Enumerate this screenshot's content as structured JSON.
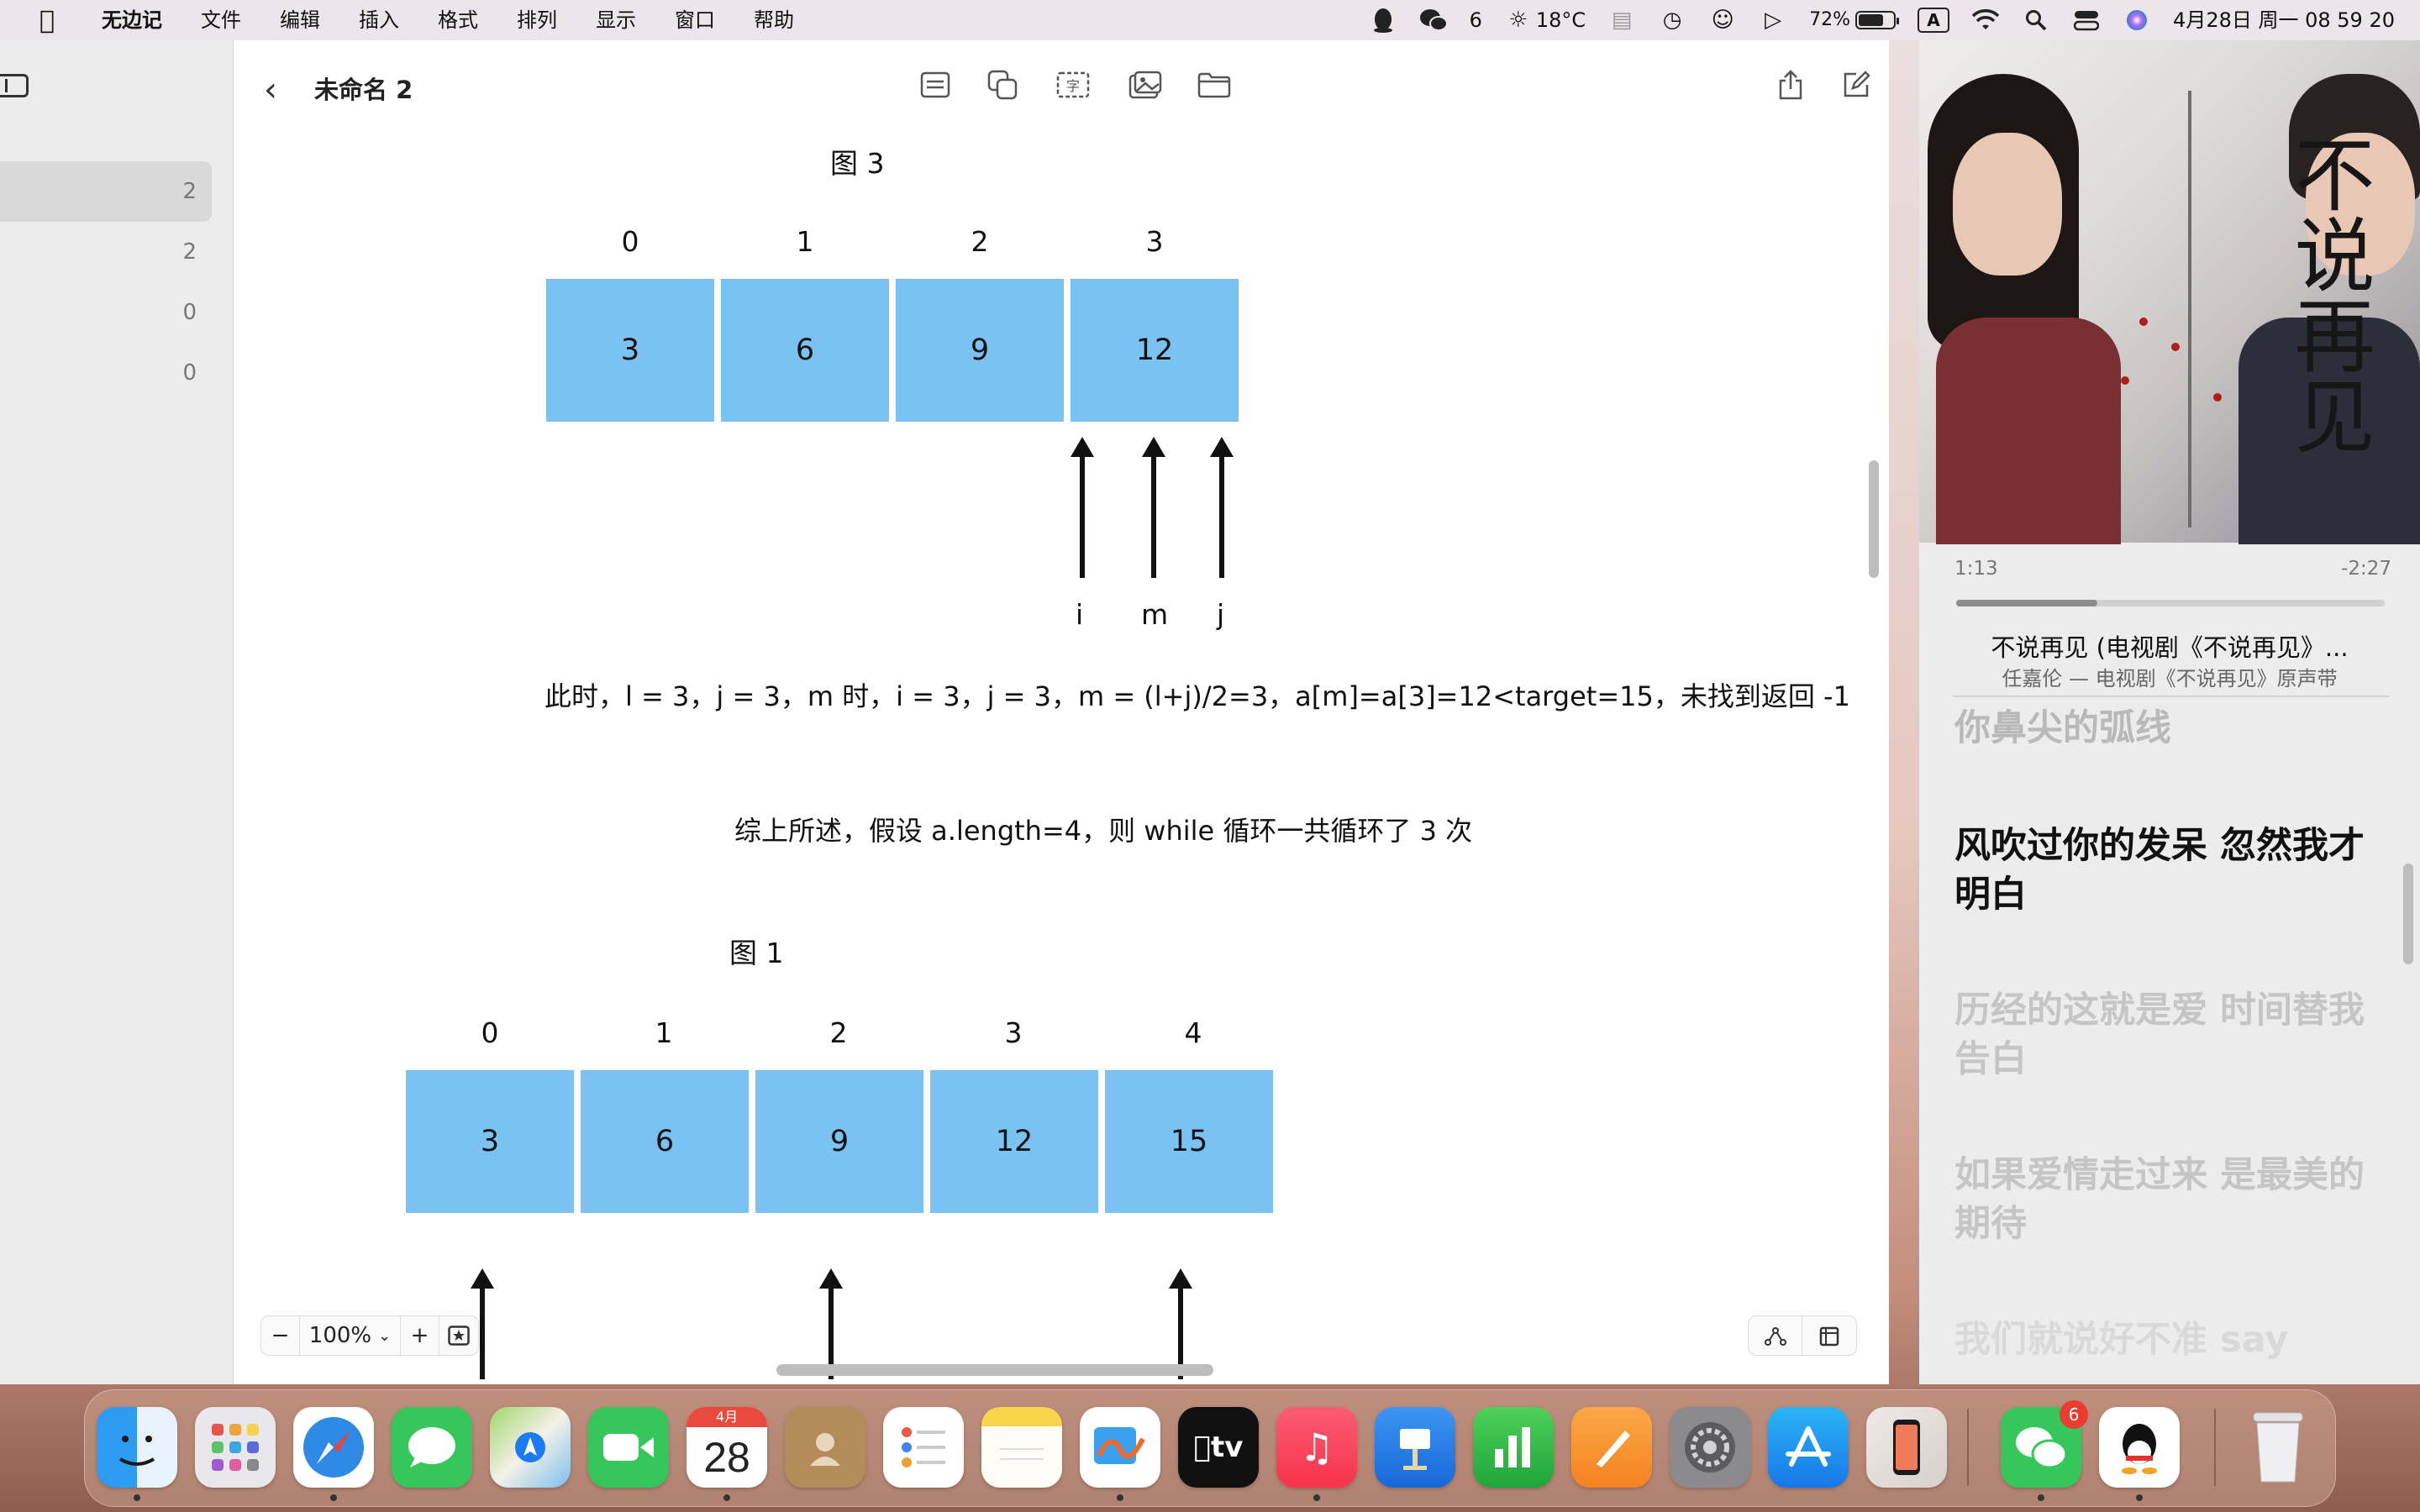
{
  "menubar": {
    "app_name": "无边记",
    "menus": [
      "文件",
      "编辑",
      "插入",
      "格式",
      "排列",
      "显示",
      "窗口",
      "帮助"
    ],
    "wechat_count": "6",
    "weather": "18°C",
    "battery": "72%",
    "battery_level": 0.72,
    "ime": "A",
    "datetime": "4月28日 周一  08 59 20"
  },
  "sidebar": {
    "rows": [
      "2",
      "2",
      "0",
      "0"
    ]
  },
  "document": {
    "title": "未命名 2",
    "fig3": {
      "label": "图 3",
      "indices": [
        "0",
        "1",
        "2",
        "3"
      ],
      "values": [
        "3",
        "6",
        "9",
        "12"
      ],
      "pointers": [
        "i",
        "m",
        "j"
      ]
    },
    "explanation": "此时，l = 3，j = 3，m 时，i = 3，j = 3，m = (l+j)/2=3，a[m]=a[3]=12<target=15，未找到返回 -1",
    "summary": "综上所述，假设 a.length=4，则 while 循环一共循环了 3 次",
    "fig1": {
      "label": "图 1",
      "indices": [
        "0",
        "1",
        "2",
        "3",
        "4"
      ],
      "values": [
        "3",
        "6",
        "9",
        "12",
        "15"
      ]
    },
    "zoom": "100%"
  },
  "music": {
    "poster_title": "不说再见",
    "elapsed": "1:13",
    "remaining": "-2:27",
    "progress": 0.33,
    "song_title": "不说再见 (电视剧《不说再见》...",
    "song_artist": "任嘉伦 — 电视剧《不说再见》原声带",
    "lyrics": {
      "prev": "你鼻尖的弧线",
      "current": "风吹过你的发呆 忽然我才明白",
      "next1": "历经的这就是爱 时间替我告白",
      "next2": "如果爱情走过来 是最美的期待",
      "next3": "我们就说好不准 say"
    }
  },
  "dock": {
    "calendar_month": "4月",
    "calendar_day": "28",
    "wechat_badge": "6",
    "apps": [
      "finder-icon",
      "launchpad-icon",
      "safari-icon",
      "messages-icon",
      "maps-icon",
      "facetime-icon",
      "calendar-icon",
      "contacts-icon",
      "reminders-icon",
      "notes-icon",
      "freeform-icon",
      "apple-tv-icon",
      "music-icon",
      "keynote-icon",
      "numbers-icon",
      "pages-icon",
      "system-settings-icon",
      "app-store-icon",
      "iphone-mirroring-icon",
      "wechat-icon",
      "qq-icon",
      "trash-icon"
    ]
  }
}
